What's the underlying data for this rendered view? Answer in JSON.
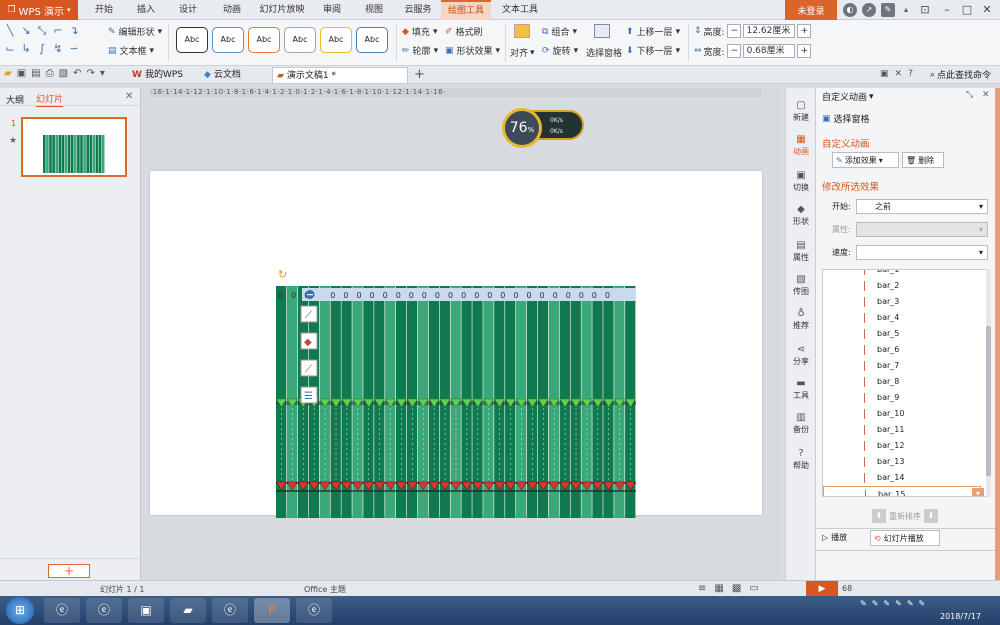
{
  "app": {
    "name": "WPS 演示",
    "login": "未登录"
  },
  "menu": [
    "开始",
    "插入",
    "设计",
    "动画",
    "幻灯片放映",
    "审阅",
    "视图",
    "云服务",
    "绘图工具",
    "文本工具"
  ],
  "menu_active": "绘图工具",
  "ribbon": {
    "edit_shape": "编辑形状",
    "textbox": "文本框",
    "style_label": "Abc",
    "fill": "填充",
    "format_painter": "格式刷",
    "outline": "轮廓",
    "shape_effects": "形状效果",
    "combine": "组合",
    "align": "对齐",
    "rotate": "旋转",
    "select_pane": "选择窗格",
    "bring_forward": "上移一层",
    "send_backward": "下移一层",
    "height_label": "高度:",
    "height_value": "12.62厘米",
    "width_label": "宽度:",
    "width_value": "0.68厘米"
  },
  "doc_tabs": [
    "我的WPS",
    "云文档",
    "演示文稿1 *"
  ],
  "search_placeholder": "点此查找命令",
  "left_panel": {
    "tab_outline": "大纲",
    "tab_slides": "幻灯片",
    "slide_number": "1"
  },
  "canvas": {
    "ruler": "·16·1·14·1·12·1·10·1·8·1·6·1·4·1·2·1·0·1·2·1·4·1·6·1·8·1·10·1·12·1·14·1·16·",
    "zero_labels": [
      "0",
      "0",
      "0",
      "0",
      "0",
      "0",
      "0",
      "0",
      "0",
      "0",
      "0",
      "0",
      "0",
      "0",
      "0",
      "0",
      "0",
      "0",
      "0",
      "0",
      "0",
      "0",
      "0",
      "0",
      "0",
      "0"
    ],
    "speed_percent": "76",
    "speed_unit": "%",
    "upload": "0K/s",
    "download": "0K/s"
  },
  "side_tools": [
    "新建",
    "动画",
    "切换",
    "形状",
    "属性",
    "传图",
    "推荐",
    "分享",
    "工具",
    "备份",
    "帮助"
  ],
  "anim_panel": {
    "title": "自定义动画",
    "select_pane": "选择窗格",
    "section_title": "自定义动画",
    "add_effect": "添加效果",
    "delete": "删除",
    "modify_title": "修改所选效果",
    "start_label": "开始:",
    "start_value": "之前",
    "property_label": "属性:",
    "speed_label": "速度:",
    "items": [
      "bar_1",
      "bar_2",
      "bar_3",
      "bar_4",
      "bar_5",
      "bar_6",
      "bar_7",
      "bar_8",
      "bar_9",
      "bar_10",
      "bar_11",
      "bar_12",
      "bar_13",
      "bar_14",
      "bar_15"
    ],
    "reorder": "重新排序",
    "play": "播放",
    "slideshow": "幻灯片播放"
  },
  "status": {
    "slide": "幻灯片 1 / 1",
    "theme": "Office 主题",
    "zoom": "68"
  },
  "taskbar": {
    "date": "2018/7/17"
  },
  "colors": {
    "accent": "#d8561f",
    "bar_dark": "#0f7a4e",
    "bar_light": "#3aa878"
  }
}
